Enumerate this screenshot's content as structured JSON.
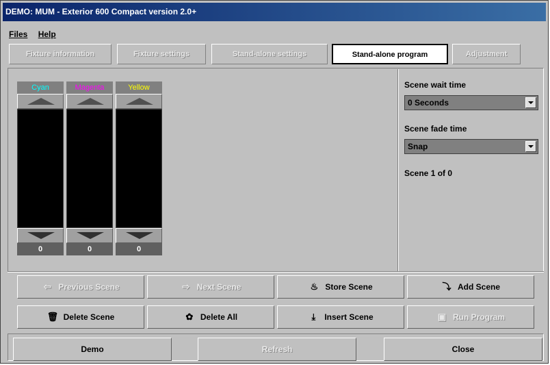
{
  "window": {
    "title": "DEMO: MUM - Exterior 600 Compact version 2.0+"
  },
  "menu": {
    "files": "Files",
    "help": "Help"
  },
  "tabs": [
    {
      "label": "Fixture information",
      "active": false
    },
    {
      "label": "Fixture settings",
      "active": false
    },
    {
      "label": "Stand-alone settings",
      "active": false
    },
    {
      "label": "Stand-alone program",
      "active": true
    },
    {
      "label": "Adjustment",
      "active": false
    }
  ],
  "faders": [
    {
      "label": "Cyan",
      "color": "#00ffff",
      "value": "0"
    },
    {
      "label": "Magenta",
      "color": "#ff00ff",
      "value": "0"
    },
    {
      "label": "Yellow",
      "color": "#ffff00",
      "value": "0"
    }
  ],
  "scene": {
    "wait_label": "Scene wait time",
    "wait_value": "0 Seconds",
    "fade_label": "Scene fade time",
    "fade_value": "Snap",
    "count_text": "Scene 1 of 0"
  },
  "buttons": {
    "previous": "Previous Scene",
    "next": "Next Scene",
    "store": "Store Scene",
    "add": "Add Scene",
    "delete": "Delete Scene",
    "delete_all": "Delete All",
    "insert": "Insert Scene",
    "run": "Run Program"
  },
  "footer": {
    "demo": "Demo",
    "refresh": "Refresh",
    "close": "Close"
  }
}
